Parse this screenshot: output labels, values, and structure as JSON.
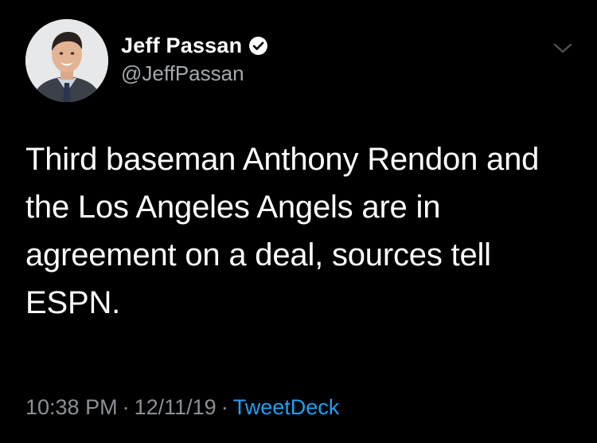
{
  "tweet": {
    "author": {
      "display_name": "Jeff Passan",
      "handle": "@JeffPassan",
      "verified": true,
      "avatar_icon": "profile-photo"
    },
    "text_lines": [
      "Third baseman Anthony Rendon and",
      "the Los Angeles Angels are in",
      "agreement on a deal, sources tell",
      "ESPN."
    ],
    "time": "10:38 PM",
    "separator": "·",
    "date": "12/11/19",
    "source": "TweetDeck"
  },
  "colors": {
    "background": "#000000",
    "text": "#ffffff",
    "muted": "#8c9196",
    "link": "#1da1f2"
  },
  "icons": {
    "verified": "verified-badge-icon",
    "menu": "chevron-down-icon"
  }
}
